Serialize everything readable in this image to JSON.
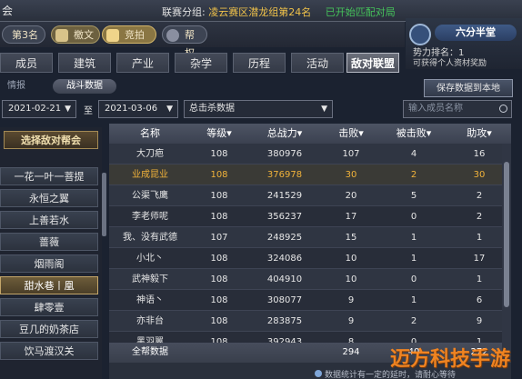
{
  "top": {
    "guild_name": "会",
    "server_label": "联赛分组:",
    "server_value": "凌云赛区潜龙组第24名",
    "status_tag": "已开始匹配对局"
  },
  "sub": {
    "rank": "第3名",
    "pill1": "檄文",
    "pill2": "竞拍",
    "pill3": "帮权"
  },
  "profile": {
    "name": "六分半堂",
    "power": "势力排名：1",
    "reward": "可获得个人资材奖励"
  },
  "tabs": [
    "成员",
    "建筑",
    "产业",
    "杂学",
    "历程",
    "活动",
    "敌对联盟"
  ],
  "active_tab": "敌对联盟",
  "subtabs": {
    "info": "情报",
    "battle": "战斗数据"
  },
  "save_button": "保存数据到本地",
  "filters": {
    "start_date": "2021-02-21",
    "to": "至",
    "end_date": "2021-03-06",
    "select_value": "总击杀数据",
    "search_placeholder": "输入成员名称"
  },
  "left": {
    "header": "选择敌对帮会",
    "unions": [
      "一花一叶一菩提",
      "永恒之翼",
      "上善若水",
      "蔷薇",
      "烟雨阁",
      "甜水巷丨凰",
      "肆零壹",
      "豆几的奶茶店",
      "饮马渡汉关"
    ],
    "selected": "甜水巷丨凰"
  },
  "table": {
    "headers": [
      "名称",
      "等级▾",
      "总战力▾",
      "击败▾",
      "被击败▾",
      "助攻▾"
    ],
    "rows": [
      [
        "大刀疤",
        "108",
        "380976",
        "107",
        "4",
        "16"
      ],
      [
        "业成昆业",
        "108",
        "376978",
        "30",
        "2",
        "30"
      ],
      [
        "公渠飞鹰",
        "108",
        "241529",
        "20",
        "5",
        "2"
      ],
      [
        "李老师呢",
        "108",
        "356237",
        "17",
        "0",
        "2"
      ],
      [
        "我、没有武德",
        "107",
        "248925",
        "15",
        "1",
        "1"
      ],
      [
        "小北丶",
        "108",
        "324086",
        "10",
        "1",
        "17"
      ],
      [
        "武神毅下",
        "108",
        "404910",
        "10",
        "0",
        "1"
      ],
      [
        "神语丶",
        "108",
        "308077",
        "9",
        "1",
        "6"
      ],
      [
        "亦非台",
        "108",
        "283875",
        "9",
        "2",
        "9"
      ],
      [
        "黑羽翼",
        "108",
        "392943",
        "8",
        "0",
        "1"
      ]
    ],
    "total_label": "全帮数据",
    "total_kills": "294",
    "total_deaths": "40",
    "total_assists": "272"
  },
  "footer_note": "数据统计有一定的延时，请耐心等待",
  "watermark": "迈方科技手游网"
}
